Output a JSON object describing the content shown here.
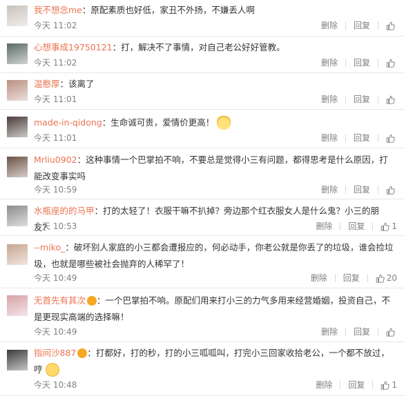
{
  "labels": {
    "delete": "删除",
    "reply": "回复"
  },
  "comments": [
    {
      "user": "我不想念me",
      "sep": "：",
      "text": "原配素质也好低，家丑不外扬，不嫌丢人啊",
      "time": "今天 11:02",
      "likes": "",
      "avatar_color": "#c9c2bb",
      "emoji": ""
    },
    {
      "user": "心想事成19750121",
      "sep": "：",
      "text": "打，解决不了事情，对自己老公好好管教。",
      "time": "今天 11:02",
      "likes": "",
      "avatar_color": "#5a6a64",
      "emoji": ""
    },
    {
      "user": "温憨厚",
      "sep": "：",
      "text": "该离了",
      "time": "今天 11:01",
      "likes": "",
      "avatar_color": "#b98f80",
      "emoji": ""
    },
    {
      "user": "made-in-qidong",
      "sep": "：",
      "text": "生命诚可贵，爱情价更高！",
      "time": "今天 11:01",
      "likes": "",
      "avatar_color": "#4a3c3a",
      "emoji": "cat-face"
    },
    {
      "user": "Mrliu0902",
      "sep": "：",
      "text": "这种事情一个巴掌拍不响，不要总是觉得小三有问题，都得思考是什么原因，打能改变事实吗",
      "time": "今天 10:59",
      "likes": "",
      "avatar_color": "#6b5244",
      "emoji": ""
    },
    {
      "user": "水瓶座的的马甲",
      "sep": "：",
      "text": "打的太轻了！衣服干嘛不扒掉？旁边那个红衣服女人是什么鬼？小三的朋友？",
      "time": "今天 10:53",
      "likes": "1",
      "avatar_color": "#8c8c8c",
      "emoji": ""
    },
    {
      "user": "--miko_",
      "sep": "：",
      "text": "破坏别人家庭的小三都会遭报应的，何必动手，你老公就是你丢了的垃圾，谁会捡垃圾，也就是哪些被社会抛弃的人稀罕了！",
      "time": "今天 10:49",
      "likes": "20",
      "avatar_color": "#c7a58f",
      "emoji": ""
    },
    {
      "user": "无首先有其次",
      "sep": "：",
      "text": "一个巴掌拍不响。原配们用来打小三的力气多用来经营婚姻，投资自己，不是更现实高端的选择嘛！",
      "time": "今天 10:49",
      "likes": "",
      "avatar_color": "#d7a2a8",
      "emoji": ""
    },
    {
      "user": "指间沙887",
      "sep": "：",
      "text": "打都好，打的秒，打的小三呱呱叫，打完小三回家收拾老公，一个都不放过，哼",
      "time": "今天 10:48",
      "likes": "1",
      "avatar_color": "#3a3a3a",
      "emoji": "sad-face"
    }
  ]
}
